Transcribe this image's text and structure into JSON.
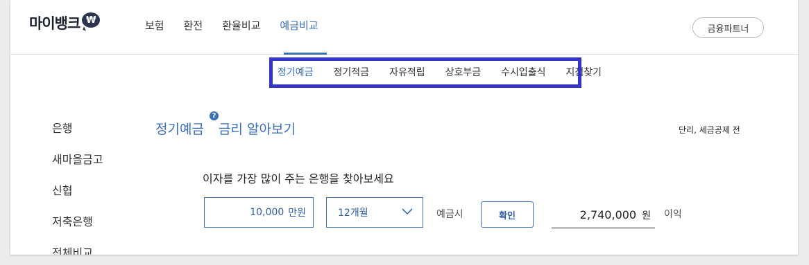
{
  "header": {
    "logo_text": "마이뱅크",
    "logo_badge": "₩",
    "nav": [
      {
        "label": "보험"
      },
      {
        "label": "환전"
      },
      {
        "label": "환율비교"
      },
      {
        "label": "예금비교"
      }
    ],
    "partner_button": "금융파트너"
  },
  "subnav": [
    {
      "label": "정기예금"
    },
    {
      "label": "정기적금"
    },
    {
      "label": "자유적립"
    },
    {
      "label": "상호부금"
    },
    {
      "label": "수시입출식"
    },
    {
      "label": "지점찾기"
    }
  ],
  "sidebar": [
    {
      "label": "은행"
    },
    {
      "label": "새마을금고"
    },
    {
      "label": "신협"
    },
    {
      "label": "저축은행"
    },
    {
      "label": "전체비교"
    }
  ],
  "main": {
    "title_left": "정기예금",
    "help_icon": "?",
    "title_right": "금리 알아보기",
    "note": "단리, 세금공제 전",
    "prompt": "이자를 가장 많이 주는 은행을 찾아보세요",
    "amount_value": "10,000",
    "amount_unit": "만원",
    "period_value": "12개월",
    "deposit_label": "예금시",
    "confirm_button": "확인",
    "result_value": "2,740,000",
    "result_unit": "원",
    "interest_label": "이익"
  },
  "colors": {
    "accent": "#3b6fb6",
    "highlight_box": "#3535c8"
  },
  "icons": {
    "logo_badge": "won-speech-bubble-icon",
    "help": "question-icon",
    "select": "chevron-down-icon"
  }
}
